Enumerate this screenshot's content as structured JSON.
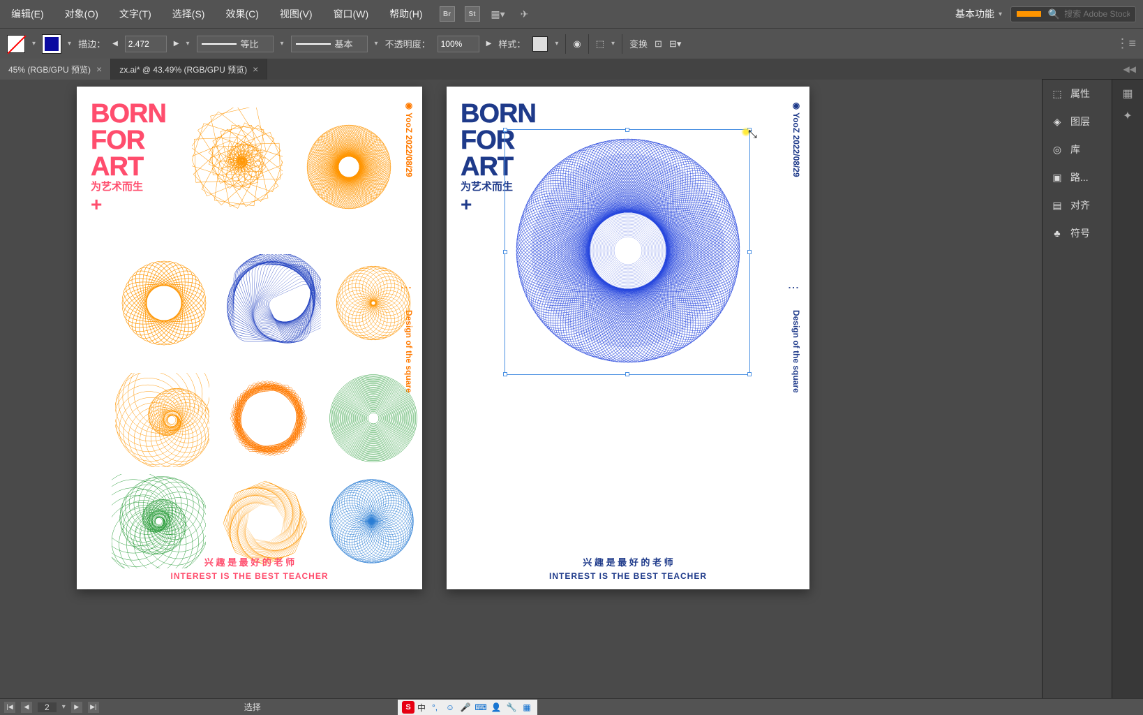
{
  "menubar": {
    "items": [
      "编辑(E)",
      "对象(O)",
      "文字(T)",
      "选择(S)",
      "效果(C)",
      "视图(V)",
      "窗口(W)",
      "帮助(H)"
    ],
    "br": "Br",
    "st": "St",
    "workspace": "基本功能",
    "search_placeholder": "搜索 Adobe Stock"
  },
  "controlbar": {
    "stroke_label": "描边：",
    "stroke_weight": "2.472",
    "profile": "等比",
    "brush": "基本",
    "opacity_label": "不透明度：",
    "opacity_value": "100%",
    "style_label": "样式：",
    "transform": "变换"
  },
  "tabs": [
    {
      "label": "45% (RGB/GPU 预览)",
      "active": false
    },
    {
      "label": "zx.ai* @ 43.49% (RGB/GPU 预览)",
      "active": true
    }
  ],
  "panels": {
    "items": [
      {
        "icon": "cube-icon",
        "glyph": "⬚",
        "label": "属性"
      },
      {
        "icon": "layers-icon",
        "glyph": "◈",
        "label": "图层"
      },
      {
        "icon": "cc-icon",
        "glyph": "◎",
        "label": "库"
      },
      {
        "icon": "pathfinder-icon",
        "glyph": "▣",
        "label": "路..."
      },
      {
        "icon": "align-icon",
        "glyph": "▤",
        "label": "对齐"
      },
      {
        "icon": "symbol-icon",
        "glyph": "♣",
        "label": "符号"
      }
    ],
    "collapse": "◀◀"
  },
  "statusbar": {
    "artboard": "2",
    "tool": "选择"
  },
  "poster": {
    "t1": "BORN",
    "t2": "FOR",
    "t3": "ART",
    "sub": "为艺术而生",
    "plus": "+",
    "side_brand": "◉ YooZ  2022/08/29",
    "side_desc": "Design of the square",
    "foot_ch": "兴 趣 是 最 好 的 老 师",
    "foot_en": "INTEREST IS THE BEST TEACHER"
  },
  "ime": {
    "lang": "中",
    "s": "S"
  }
}
